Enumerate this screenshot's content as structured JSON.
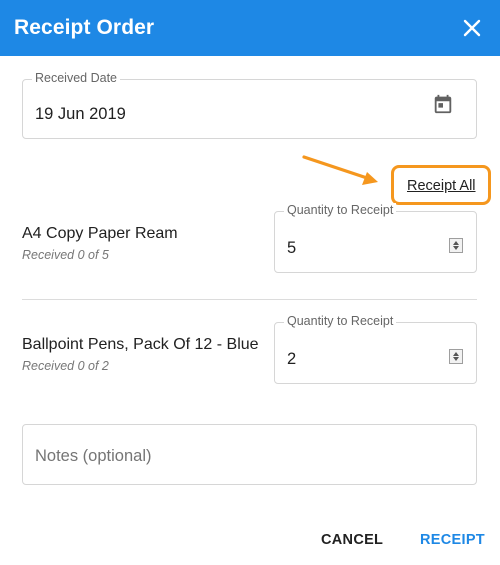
{
  "dialog": {
    "title": "Receipt Order",
    "close_icon": "close-icon"
  },
  "received_date": {
    "label": "Received Date",
    "value": "19 Jun 2019",
    "icon": "calendar-icon"
  },
  "receipt_all": {
    "label": "Receipt All",
    "highlight_color": "#f5971e"
  },
  "items": [
    {
      "name": "A4 Copy Paper Ream",
      "received": "Received 0 of 5",
      "quantity_label": "Quantity to Receipt",
      "quantity": "5"
    },
    {
      "name": "Ballpoint Pens, Pack Of 12 - Blue",
      "received": "Received 0 of 2",
      "quantity_label": "Quantity to Receipt",
      "quantity": "2"
    }
  ],
  "notes": {
    "placeholder": "Notes (optional)"
  },
  "actions": {
    "cancel": "CANCEL",
    "receipt": "RECEIPT"
  },
  "colors": {
    "header": "#1e88e5",
    "primary_action": "#1e88e5",
    "annotation": "#f5971e"
  }
}
